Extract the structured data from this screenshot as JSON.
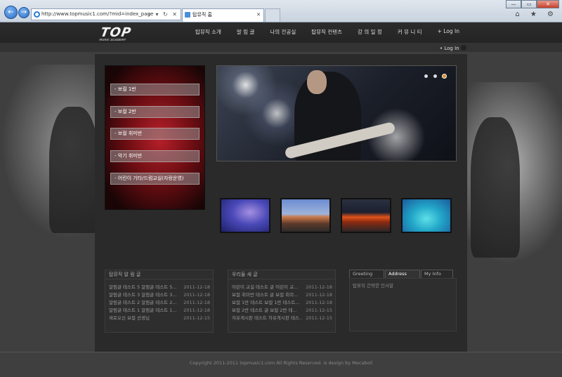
{
  "browser": {
    "back_glyph": "←",
    "forward_glyph": "→",
    "address": "http://www.topmusic1.com/?mid=index_page",
    "address_tools": "⌕ ▾ ↻ ✕",
    "tab_title": "탑뮤직 홈",
    "tab_close": "✕",
    "window_buttons": [
      "—",
      "▭",
      "✕"
    ],
    "tools": "⌂ ★ ⚙"
  },
  "site": {
    "logo": "TOP",
    "logo_sub": "MUSIC ACADEMY",
    "menu": [
      "탑뮤직 소개",
      "알 림 글",
      "나의 전공실",
      "탑뮤직 컨텐츠",
      "강 의 일 정",
      "커 뮤 니 티",
      "+ Log In"
    ],
    "login_link": "• Log In",
    "lessons": [
      "- 보컬 1반",
      "- 보컬 2반",
      "- 보컬 취미반",
      "- 악기 취미반",
      "- 어린이 기타/드럼교실(자랑운영)"
    ],
    "board_notice": {
      "title": "탑뮤직 알 림 글",
      "rows": [
        {
          "text": "알림글 테스트 5 알림글 테스트 5...",
          "date": "2011-12-18"
        },
        {
          "text": "알림글 테스트 3 알림글 테스트 3...",
          "date": "2011-12-18"
        },
        {
          "text": "알림글 테스트 2 알림글 테스트 2...",
          "date": "2011-12-18"
        },
        {
          "text": "알림글 테스트 1 알림글 테스트 1...",
          "date": "2011-12-18"
        },
        {
          "text": "새로오신 보컬 선생님",
          "date": "2011-12-15"
        }
      ]
    },
    "board_new": {
      "title": "우리들 새 글",
      "rows": [
        {
          "text": "어린이 교실 테스트 글 어린이 교...",
          "date": "2011-12-18"
        },
        {
          "text": "보컬 취미반 테스트 글 보컬 취미...",
          "date": "2011-12-18"
        },
        {
          "text": "보컬 1반 테스트 보컬 1반 테스트...",
          "date": "2011-12-18"
        },
        {
          "text": "보컬 2반 테스트 글 보컬 2반 테...",
          "date": "2011-12-15"
        },
        {
          "text": "자유게시판 테스트 자유게시판 테스...",
          "date": "2011-12-15"
        }
      ]
    },
    "info_tabs": [
      "Greeting",
      "Address",
      "My Info"
    ],
    "info_active_tab": "Address",
    "greeting_text": "탑뮤직 간략한 인사말",
    "copyright": "Copyright 2011-2011 topmusic1.com All Rights Reserved. is design by Mecaboil"
  }
}
